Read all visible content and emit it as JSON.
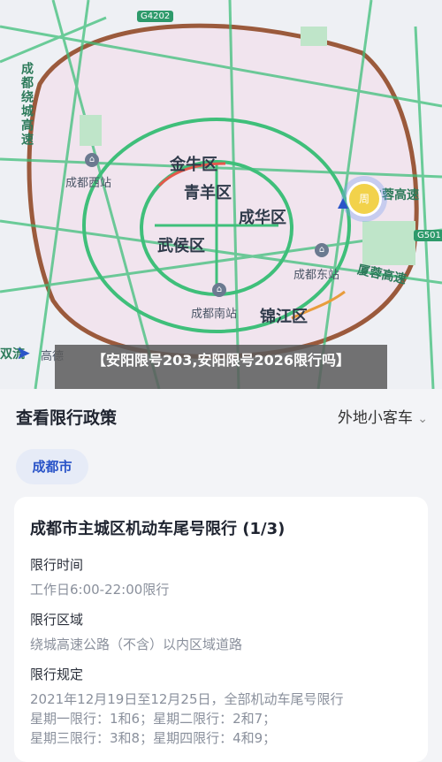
{
  "map": {
    "highway_shield": "G4202",
    "side_shield": "G501",
    "labels": {
      "jinniu": "金牛区",
      "qingyang": "青羊区",
      "chenghua": "成华区",
      "wuhou": "武侯区",
      "jinjiang": "锦江区",
      "chengdu_west": "成都西站",
      "chengdu_east": "成都东站",
      "chengdu_south": "成都南站",
      "ring_highway": "成都绕城高速",
      "rongxia": "厦蓉高速",
      "right_top_road": "中蓉高速",
      "left_partial": "双流",
      "bottom_left_partial": "高德",
      "marker_text": "周"
    }
  },
  "banner": {
    "text": "【安阳限号203,安阳限号2026限行吗】"
  },
  "policy": {
    "title": "查看限行政策",
    "vehicle_type": "外地小客车",
    "city": "成都市",
    "card_title": "成都市主城区机动车尾号限行 (1/3)",
    "time_label": "限行时间",
    "time_value": "工作日6:00-22:00限行",
    "area_label": "限行区域",
    "area_value": "绕城高速公路（不含）以内区域道路",
    "rule_label": "限行规定",
    "rule_lines": [
      "2021年12月19日至12月25日，全部机动车尾号限行",
      "星期一限行：1和6；星期二限行：2和7；",
      "星期三限行：3和8；星期四限行：4和9；"
    ]
  },
  "colors": {
    "ring_road": "#9b5a3c",
    "green_road": "#3fbf7a",
    "city_fill": "#f1e4ee",
    "accent": "#2a54c8"
  }
}
